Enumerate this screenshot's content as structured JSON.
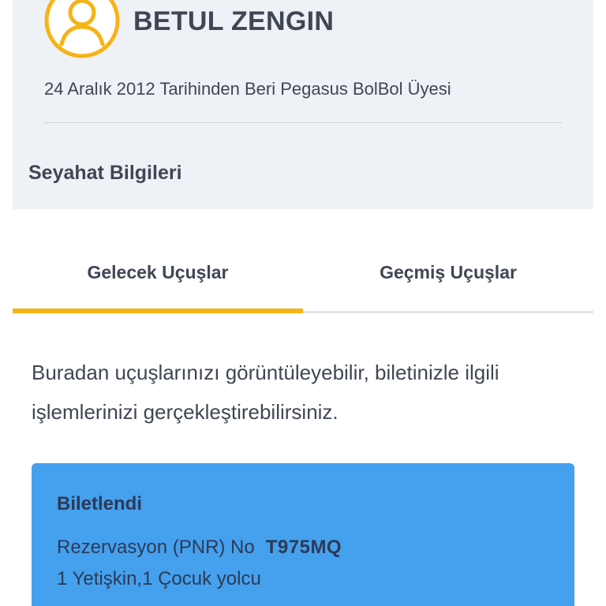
{
  "profile": {
    "name": "BETUL ZENGIN",
    "member_since": "24 Aralık 2012 Tarihinden Beri Pegasus BolBol Üyesi",
    "avatar_icon": "user-icon",
    "accent_color": "#f5b417"
  },
  "travel": {
    "section_title": "Seyahat Bilgileri",
    "tabs": [
      {
        "label": "Gelecek Uçuşlar",
        "active": true
      },
      {
        "label": "Geçmiş Uçuşlar",
        "active": false
      }
    ],
    "description": "Buradan uçuşlarınızı görüntüleyebilir, biletinizle ilgili işlemlerinizi gerçekleştirebilirsiniz."
  },
  "ticket": {
    "status": "Biletlendi",
    "pnr_label": "Rezervasyon (PNR) No",
    "pnr_code": "T975MQ",
    "passengers": "1 Yetişkin,1 Çocuk yolcu",
    "card_color": "#45a0ee"
  }
}
